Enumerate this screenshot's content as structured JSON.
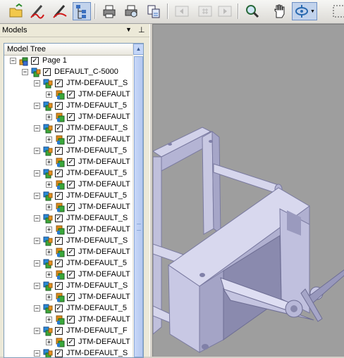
{
  "toolbar": {
    "icons": [
      "open-icon",
      "redline-icon",
      "pen-icon",
      "model-tree-icon",
      "print-icon",
      "print-preview-icon",
      "copy-view-icon",
      "previous-page-icon",
      "page-icon",
      "next-page-icon",
      "zoom-icon",
      "pan-icon",
      "orient-icon",
      "orient-dropdown-icon",
      "zoom-window-icon"
    ]
  },
  "panel": {
    "title": "Models",
    "dropdown_glyph": "▼",
    "pin_glyph": "⊥"
  },
  "tree": {
    "header": "Model Tree",
    "rows": [
      {
        "level": 0,
        "label": "Page 1",
        "expander": "−",
        "icon": "page-icon",
        "checked": true
      },
      {
        "level": 1,
        "label": "DEFAULT_C-5000",
        "expander": "−",
        "icon": "assembly-icon",
        "checked": true
      },
      {
        "level": 2,
        "label": "JTM-DEFAULT_S",
        "expander": "−",
        "icon": "assembly-icon",
        "checked": true
      },
      {
        "level": 3,
        "label": "JTM-DEFAULT",
        "expander": "+",
        "icon": "part-icon",
        "checked": true
      },
      {
        "level": 2,
        "label": "JTM-DEFAULT_5",
        "expander": "−",
        "icon": "assembly-icon",
        "checked": true
      },
      {
        "level": 3,
        "label": "JTM-DEFAULT",
        "expander": "+",
        "icon": "part-icon",
        "checked": true
      },
      {
        "level": 2,
        "label": "JTM-DEFAULT_S",
        "expander": "−",
        "icon": "assembly-icon",
        "checked": true
      },
      {
        "level": 3,
        "label": "JTM-DEFAULT",
        "expander": "+",
        "icon": "part-icon",
        "checked": true
      },
      {
        "level": 2,
        "label": "JTM-DEFAULT_5",
        "expander": "−",
        "icon": "assembly-icon",
        "checked": true
      },
      {
        "level": 3,
        "label": "JTM-DEFAULT",
        "expander": "+",
        "icon": "part-icon",
        "checked": true
      },
      {
        "level": 2,
        "label": "JTM-DEFAULT_5",
        "expander": "−",
        "icon": "assembly-icon",
        "checked": true
      },
      {
        "level": 3,
        "label": "JTM-DEFAULT",
        "expander": "+",
        "icon": "part-icon",
        "checked": true
      },
      {
        "level": 2,
        "label": "JTM-DEFAULT_5",
        "expander": "−",
        "icon": "assembly-icon",
        "checked": true
      },
      {
        "level": 3,
        "label": "JTM-DEFAULT",
        "expander": "+",
        "icon": "part-icon",
        "checked": true
      },
      {
        "level": 2,
        "label": "JTM-DEFAULT_S",
        "expander": "−",
        "icon": "assembly-icon",
        "checked": true
      },
      {
        "level": 3,
        "label": "JTM-DEFAULT",
        "expander": "+",
        "icon": "part-icon",
        "checked": true
      },
      {
        "level": 2,
        "label": "JTM-DEFAULT_S",
        "expander": "−",
        "icon": "assembly-icon",
        "checked": true
      },
      {
        "level": 3,
        "label": "JTM-DEFAULT",
        "expander": "+",
        "icon": "part-icon",
        "checked": true
      },
      {
        "level": 2,
        "label": "JTM-DEFAULT_5",
        "expander": "−",
        "icon": "assembly-icon",
        "checked": true
      },
      {
        "level": 3,
        "label": "JTM-DEFAULT",
        "expander": "+",
        "icon": "part-icon",
        "checked": true
      },
      {
        "level": 2,
        "label": "JTM-DEFAULT_S",
        "expander": "−",
        "icon": "assembly-icon",
        "checked": true
      },
      {
        "level": 3,
        "label": "JTM-DEFAULT",
        "expander": "+",
        "icon": "part-icon",
        "checked": true
      },
      {
        "level": 2,
        "label": "JTM-DEFAULT_5",
        "expander": "−",
        "icon": "assembly-icon",
        "checked": true
      },
      {
        "level": 3,
        "label": "JTM-DEFAULT",
        "expander": "+",
        "icon": "part-icon",
        "checked": true
      },
      {
        "level": 2,
        "label": "JTM-DEFAULT_F",
        "expander": "−",
        "icon": "assembly-icon",
        "checked": true
      },
      {
        "level": 3,
        "label": "JTM-DEFAULT",
        "expander": "+",
        "icon": "part-icon",
        "checked": true
      },
      {
        "level": 2,
        "label": "JTM-DEFAULT_S",
        "expander": "−",
        "icon": "assembly-icon",
        "checked": true
      }
    ]
  },
  "colors": {
    "viewport_bg": "#9e9e9e",
    "model_face": "#c8c8e6",
    "model_dark": "#8e8eb4",
    "tree_border": "#7f9db9"
  }
}
